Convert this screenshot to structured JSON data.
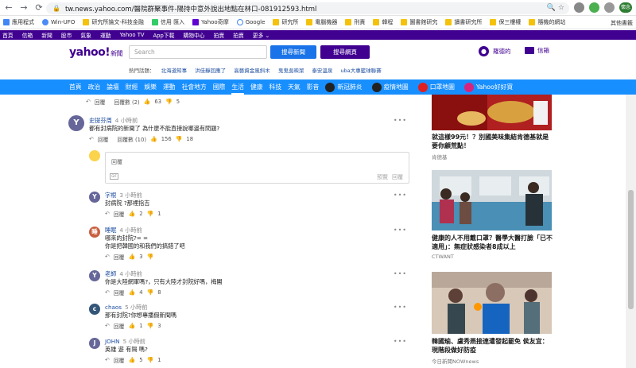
{
  "browser": {
    "url": "tw.news.yahoo.com/醫院群聚事件-陽持中意外說出地點在林口-081912593.html",
    "ext_profile": "懷念"
  },
  "bookmarks": {
    "items": [
      "應用程式",
      "Win-UFO",
      "研究所論文-科技金融",
      "信用 匯入",
      "Yahoo奇摩",
      "Google",
      "研究所",
      "電腦機器",
      "刑責",
      "韓程",
      "圖書館研究",
      "讀書研究所",
      "保三樓權",
      "隨機的網站"
    ],
    "other": "其他書籤"
  },
  "yahoo_top": [
    "首頁",
    "信箱",
    "新聞",
    "股市",
    "氣象",
    "運動",
    "Yahoo TV",
    "App下載",
    "購物中心",
    "拍賣",
    "拍賣",
    "更多 ⌄"
  ],
  "header": {
    "logo": "yahoo!",
    "logo_sub": "新聞",
    "search_placeholder": "Search",
    "btn_news": "搜尋新聞",
    "btn_web": "搜尋網頁",
    "user": "羅德的",
    "mail": "信箱",
    "trending_label": "熱門話題：",
    "trending": [
      "北海道知事",
      "洪佳靜回應了",
      "高藝資金風斜木",
      "鬼鬼吳映潔",
      "泰安溫泉",
      "uba大專籃球聯賽"
    ]
  },
  "categories": [
    "首頁",
    "政治",
    "論壇",
    "財經",
    "娛樂",
    "運動",
    "社會地方",
    "國際",
    "生活",
    "健康",
    "科技",
    "天氣",
    "影音"
  ],
  "category_chips": [
    "新冠肺炎",
    "疫情地圖",
    "口罩地圖",
    "Yahoo好好買"
  ],
  "top_actions": {
    "reply": "回覆",
    "replies": "回覆數 (2)",
    "up": "63",
    "down": "5"
  },
  "main_comment": {
    "avatar": "Y",
    "name": "史提芬周",
    "time": "4 小時前",
    "text": "都有封病院的新聞了 為什麼不能直接說哪邊有問題?",
    "reply": "回覆",
    "replies": "回覆數 (10)",
    "up": "156",
    "down": "18"
  },
  "reply_box": {
    "placeholder": "回覆",
    "gif": "GIF",
    "preview": "預覽",
    "send": "回覆"
  },
  "replies": [
    {
      "avatar": "Y",
      "name": "字根",
      "time": "3 小時前",
      "text": "封病院 ?那裡指吉",
      "reply": "回覆",
      "up": "2",
      "down": "1"
    },
    {
      "avatar": "睡",
      "name": "睡眠",
      "time": "4 小時前",
      "text": "哪來的封院?= =",
      "text2": "你是把韓國的和我們的搞錯了吧",
      "reply": "回覆",
      "up": "3",
      "down": ""
    },
    {
      "avatar": "Y",
      "name": "老師",
      "time": "4 小時前",
      "text": "你是大陸網軍嗎?，只有大陸才封院好嗎，梅閣",
      "reply": "回覆",
      "up": "4",
      "down": "8"
    },
    {
      "avatar": "c",
      "name": "chaos",
      "time": "5 小時前",
      "text": "那有封院?你想專播假新聞嗎",
      "reply": "回覆",
      "up": "1",
      "down": "3"
    },
    {
      "avatar": "J",
      "name": "JOHN",
      "time": "5 小時前",
      "text": "英雄 遊 有隔 嗎?",
      "reply": "回覆",
      "up": "5",
      "down": "1"
    }
  ],
  "right": [
    {
      "title": "就這樣99元！？別國美味集結肯德基就是要你顧荒點！",
      "source": "肯德基"
    },
    {
      "title": "健康的人不用戴口罩？醫學大醫打臉「已不適用」：無症狀感染者8成以上",
      "source": "CTWANT"
    },
    {
      "title": "韓國瑜、盧秀燕接連遭發起罷免  侯友宜：現階段做好防疫",
      "source": "今日新聞NOWnews"
    }
  ]
}
